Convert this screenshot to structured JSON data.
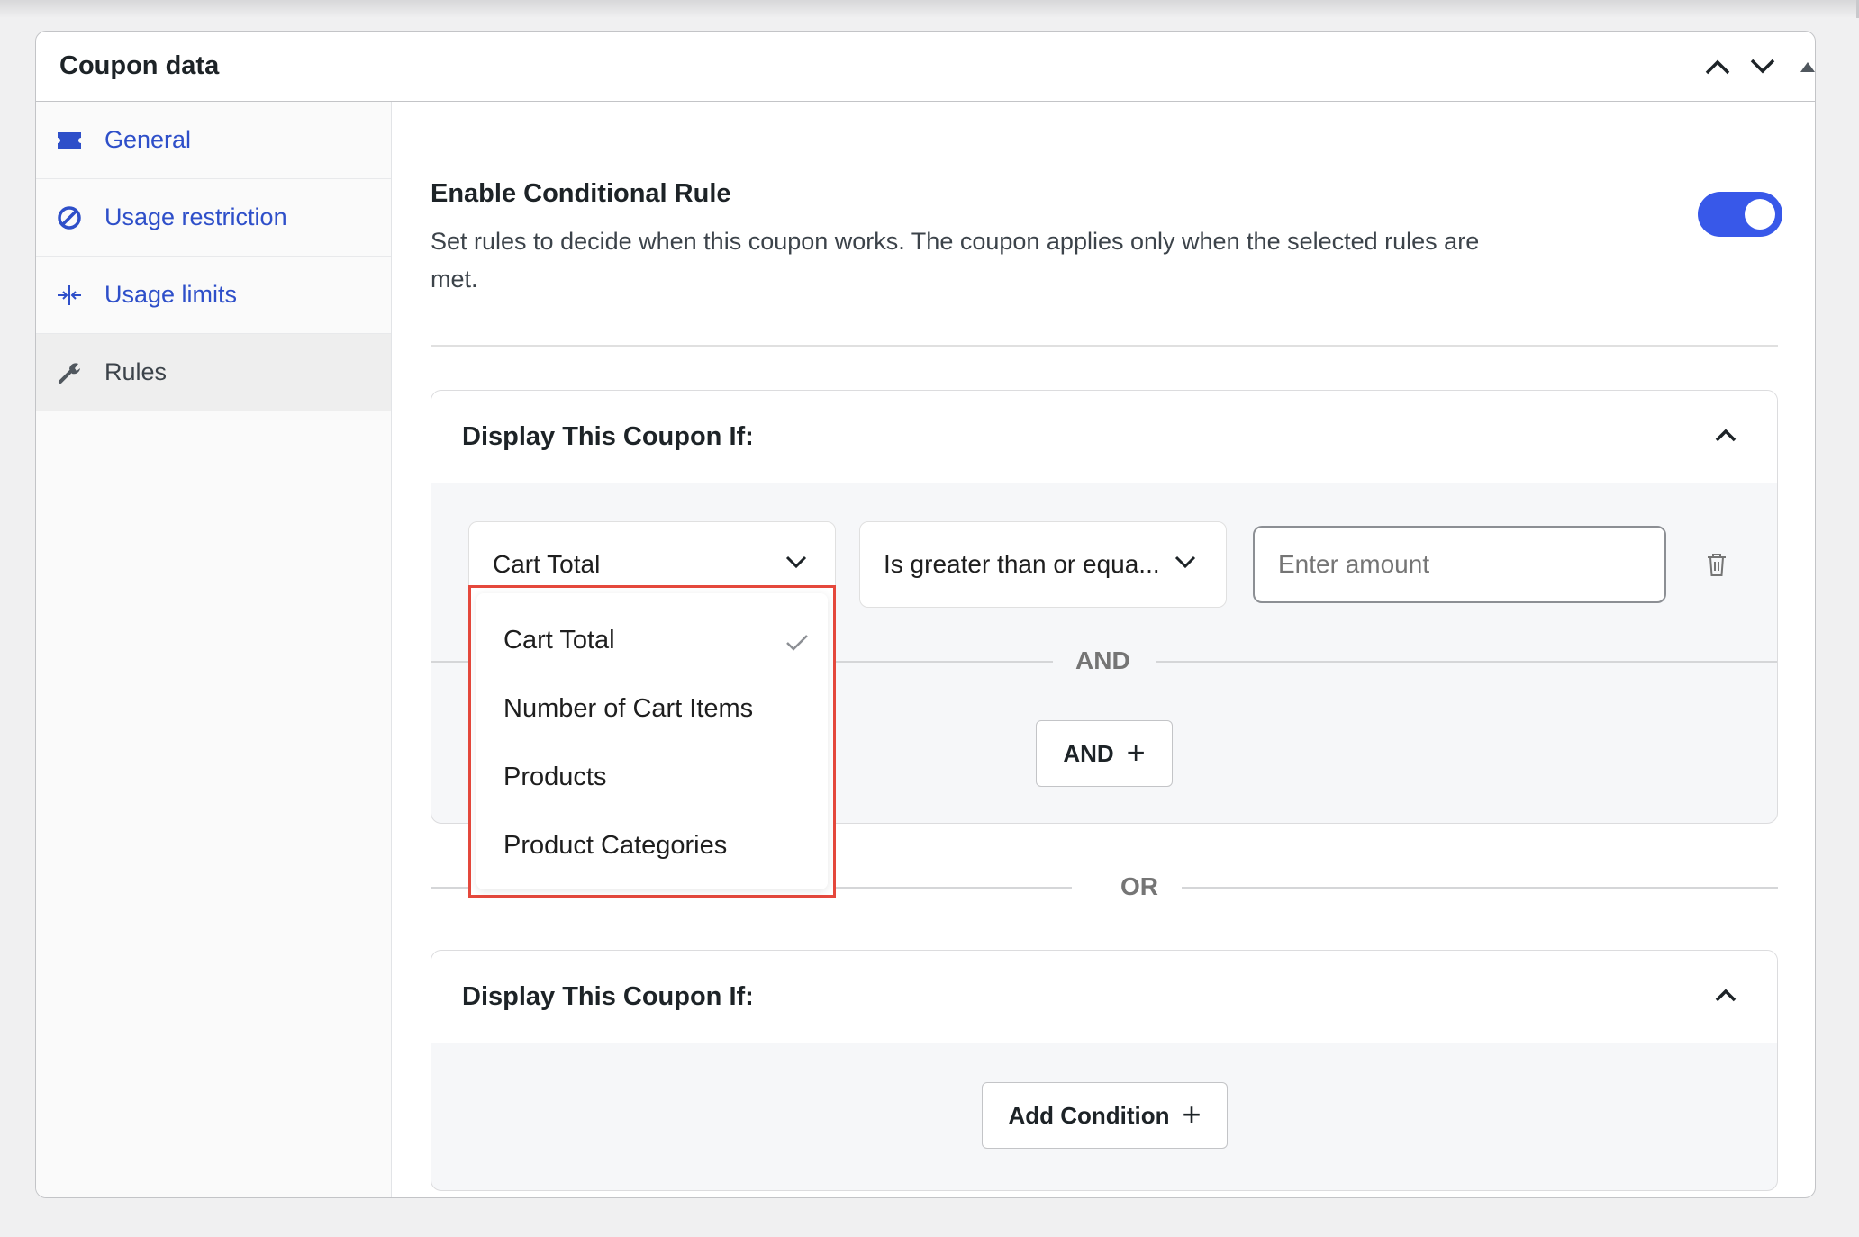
{
  "panel": {
    "title": "Coupon data",
    "header_icons": [
      "chevron-up-icon",
      "chevron-down-icon",
      "triangle-up-icon"
    ]
  },
  "sidebar": {
    "items": [
      {
        "label": "General",
        "icon": "ticket-icon",
        "active": false
      },
      {
        "label": "Usage restriction",
        "icon": "no-entry-icon",
        "active": false
      },
      {
        "label": "Usage limits",
        "icon": "arrows-in-icon",
        "active": false
      },
      {
        "label": "Rules",
        "icon": "wrench-icon",
        "active": true
      }
    ]
  },
  "rules": {
    "title": "Enable Conditional Rule",
    "description": "Set rules to decide when this coupon works. The coupon applies only when the selected rules are met.",
    "enabled": true
  },
  "groups": [
    {
      "title": "Display This Coupon If:",
      "condition": {
        "field": "Cart Total",
        "operator": "Is greater than or equa...",
        "amount_placeholder": "Enter amount"
      },
      "and_separator": "AND",
      "and_button": "AND"
    },
    {
      "title": "Display This Coupon If:",
      "add_button": "Add Condition"
    }
  ],
  "or_separator": "OR",
  "dropdown": {
    "options": [
      "Cart Total",
      "Number of Cart Items",
      "Products",
      "Product Categories"
    ],
    "selected": "Cart Total"
  },
  "colors": {
    "accent": "#3858e9",
    "link": "#2e4fc9",
    "highlight_border": "#e5483c"
  }
}
